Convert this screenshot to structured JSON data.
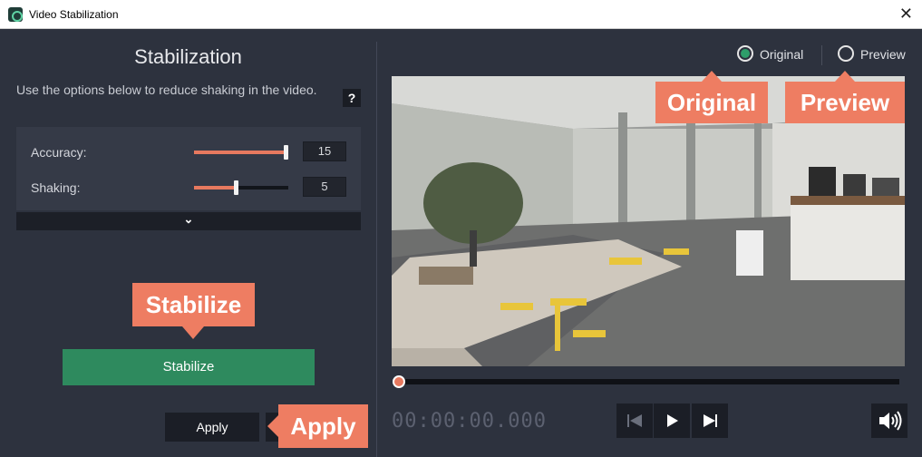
{
  "window": {
    "title": "Video Stabilization",
    "close_glyph": "✕"
  },
  "left": {
    "title": "Stabilization",
    "description": "Use the options below to reduce shaking in the video.",
    "help_label": "?",
    "settings": [
      {
        "label": "Accuracy:",
        "value": "15",
        "level": 1.0
      },
      {
        "label": "Shaking:",
        "value": "5",
        "level": 0.45
      }
    ],
    "expand_glyph": "⌄",
    "stabilize_label": "Stabilize",
    "apply_label": "Apply",
    "callout_stabilize": "Stabilize",
    "callout_apply": "Apply"
  },
  "right": {
    "radio_original": "Original",
    "radio_preview": "Preview",
    "selected": "Original",
    "callout_original": "Original",
    "callout_preview": "Preview",
    "timecode": "00:00:00.000",
    "progress": 0.0
  },
  "colors": {
    "accent": "#ee7d62",
    "green": "#2e8a5e",
    "background": "#2d323e"
  },
  "icons": [
    "app-icon",
    "close-icon",
    "help-icon",
    "chevron-down-icon",
    "skip-back-icon",
    "play-icon",
    "skip-forward-icon",
    "volume-icon"
  ]
}
